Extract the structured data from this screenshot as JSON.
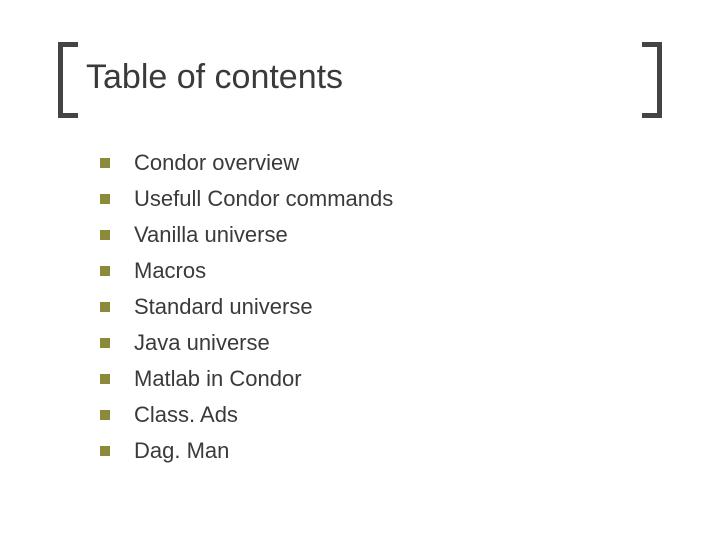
{
  "title": "Table of contents",
  "items": [
    {
      "label": "Condor overview"
    },
    {
      "label": "Usefull Condor commands"
    },
    {
      "label": "Vanilla universe"
    },
    {
      "label": "Macros"
    },
    {
      "label": "Standard universe"
    },
    {
      "label": "Java universe"
    },
    {
      "label": "Matlab in Condor"
    },
    {
      "label": "Class. Ads"
    },
    {
      "label": "Dag. Man"
    }
  ],
  "colors": {
    "bullet": "#8a8a3a",
    "bracket": "#444444",
    "text": "#3a3a3a"
  }
}
